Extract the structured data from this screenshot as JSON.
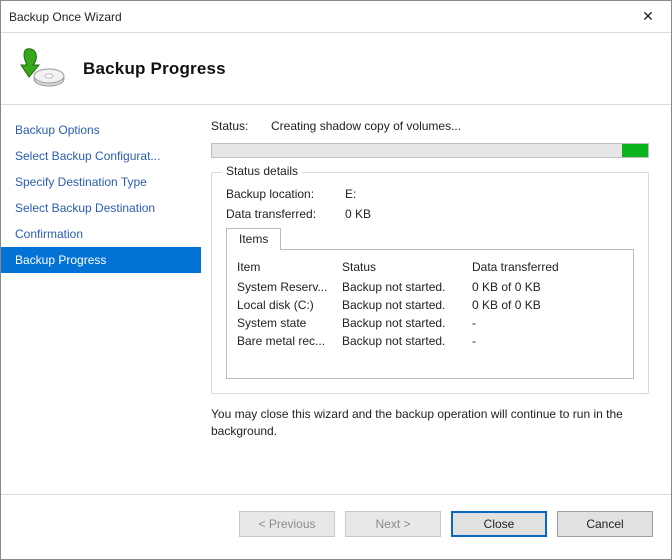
{
  "window": {
    "title": "Backup Once Wizard",
    "heading": "Backup Progress"
  },
  "sidebar": {
    "items": [
      {
        "label": "Backup Options"
      },
      {
        "label": "Select Backup Configurat..."
      },
      {
        "label": "Specify Destination Type"
      },
      {
        "label": "Select Backup Destination"
      },
      {
        "label": "Confirmation"
      },
      {
        "label": "Backup Progress"
      }
    ],
    "selectedIndex": 5
  },
  "status": {
    "label": "Status:",
    "value": "Creating shadow copy of volumes...",
    "progress_pct": 94,
    "fill_width_pct": 6
  },
  "details": {
    "group_title": "Status details",
    "backup_location_label": "Backup location:",
    "backup_location_value": "E:",
    "data_transferred_label": "Data transferred:",
    "data_transferred_value": "0 KB",
    "tab_label": "Items",
    "columns": {
      "c0": "Item",
      "c1": "Status",
      "c2": "Data transferred"
    },
    "rows": [
      {
        "item": "System Reserv...",
        "status": "Backup not started.",
        "data": "0 KB of 0 KB"
      },
      {
        "item": "Local disk (C:)",
        "status": "Backup not started.",
        "data": "0 KB of 0 KB"
      },
      {
        "item": "System state",
        "status": "Backup not started.",
        "data": "-"
      },
      {
        "item": "Bare metal rec...",
        "status": "Backup not started.",
        "data": "-"
      }
    ]
  },
  "hint": "You may close this wizard and the backup operation will continue to run in the background.",
  "footer": {
    "previous": "< Previous",
    "next": "Next >",
    "close": "Close",
    "cancel": "Cancel"
  },
  "icons": {
    "wizard": "backup-wizard-icon",
    "close_x": "✕"
  }
}
